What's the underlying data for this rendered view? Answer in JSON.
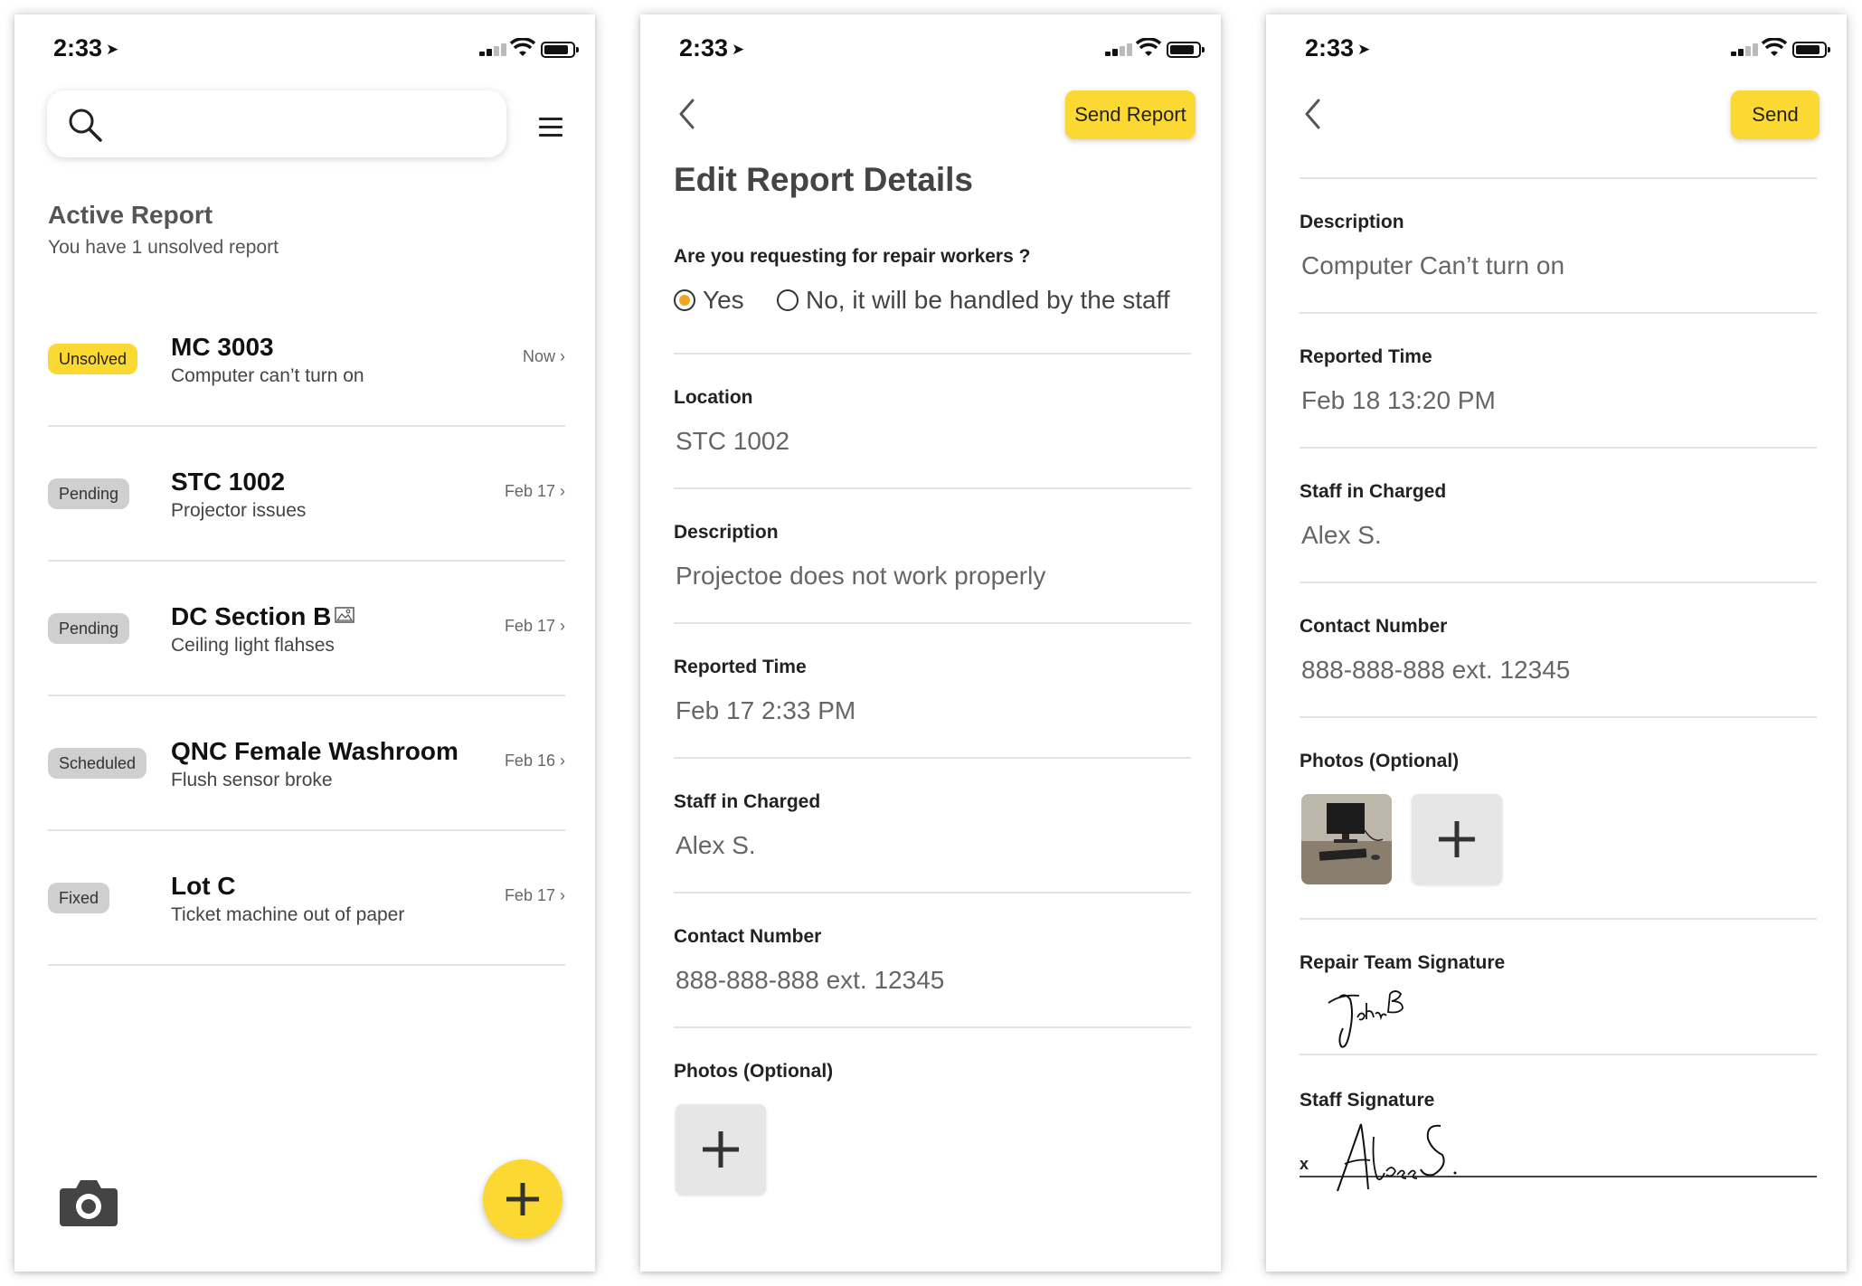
{
  "status_bar": {
    "time": "2:33"
  },
  "list_screen": {
    "title": "Active Report",
    "subtitle": "You have 1 unsolved report",
    "reports": [
      {
        "status": "Unsolved",
        "title": "MC 3003",
        "description": "Computer can’t turn on",
        "date": "Now"
      },
      {
        "status": "Pending",
        "title": "STC 1002",
        "description": "Projector issues",
        "date": "Feb 17"
      },
      {
        "status": "Pending",
        "title": "DC Section B",
        "description": "Ceiling light flahses",
        "date": "Feb 17"
      },
      {
        "status": "Scheduled",
        "title": "QNC Female Washroom",
        "description": "Flush sensor broke",
        "date": "Feb 16"
      },
      {
        "status": "Fixed",
        "title": "Lot C",
        "description": "Ticket machine out of paper",
        "date": "Feb 17"
      }
    ]
  },
  "edit_screen": {
    "send_button": "Send Report",
    "title": "Edit Report Details",
    "question": "Are you requesting for repair workers ?",
    "options": [
      "Yes",
      "No, it will be handled by the staff"
    ],
    "selected_option": "Yes",
    "fields": [
      {
        "label": "Location",
        "value": "STC 1002"
      },
      {
        "label": "Description",
        "value": "Projectoe does not work properly"
      },
      {
        "label": "Reported Time",
        "value": "Feb 17 2:33 PM"
      },
      {
        "label": "Staff in Charged",
        "value": "Alex S."
      },
      {
        "label": "Contact Number",
        "value": "888-888-888 ext. 12345"
      }
    ],
    "photos_label": "Photos (Optional)"
  },
  "detail_screen": {
    "send_button": "Send",
    "fields": [
      {
        "label": "Description",
        "value": "Computer Can’t turn on"
      },
      {
        "label": "Reported Time",
        "value": "Feb 18 13:20 PM"
      },
      {
        "label": "Staff in Charged",
        "value": "Alex S."
      },
      {
        "label": "Contact Number",
        "value": "888-888-888 ext. 12345"
      }
    ],
    "photos_label": "Photos (Optional)",
    "repair_signature_label": "Repair Team Signature",
    "staff_signature_label": "Staff Signature",
    "staff_signature_mark": "x"
  },
  "colors": {
    "accent": "#fcd832",
    "radio_selected": "#f2a51e",
    "badge_gray": "#cfcfcf"
  }
}
